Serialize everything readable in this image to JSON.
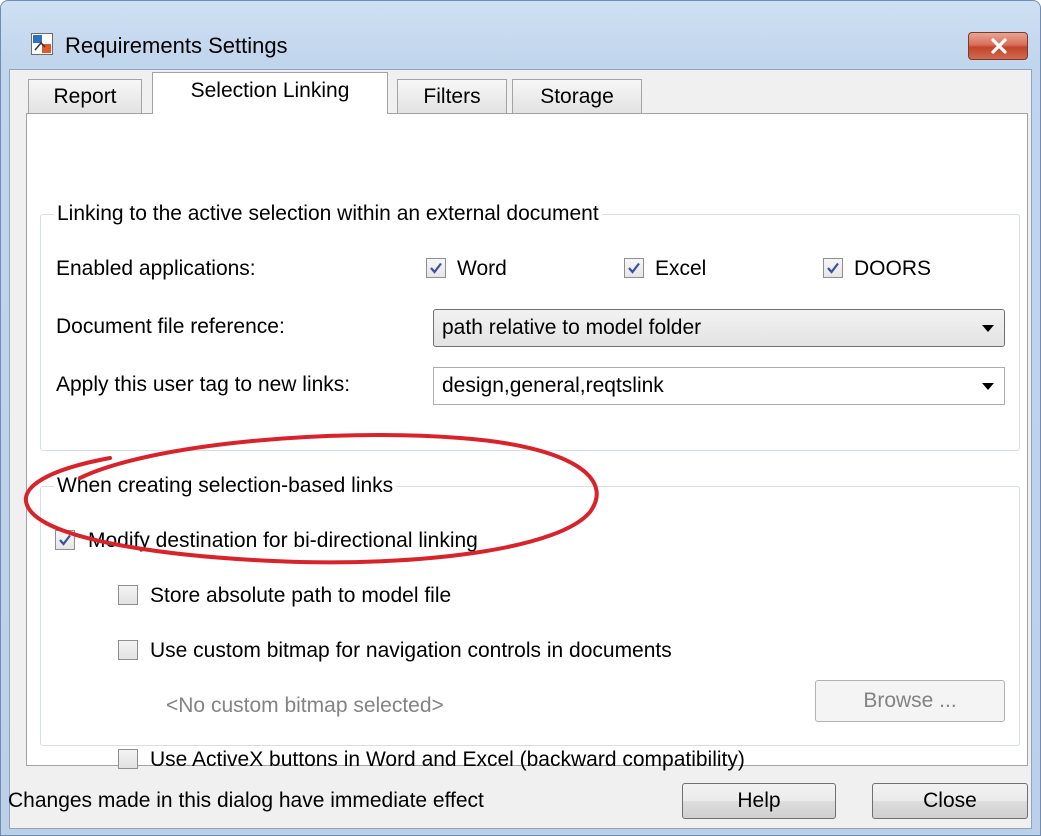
{
  "window": {
    "title": "Requirements Settings"
  },
  "tabs": [
    {
      "label": "Report"
    },
    {
      "label": "Selection Linking"
    },
    {
      "label": "Filters"
    },
    {
      "label": "Storage"
    }
  ],
  "external_group": {
    "legend": "Linking to the active selection within an external document",
    "enabled_label": "Enabled applications:",
    "apps": [
      {
        "label": "Word",
        "checked": true
      },
      {
        "label": "Excel",
        "checked": true
      },
      {
        "label": "DOORS",
        "checked": true
      }
    ],
    "doc_ref_label": "Document file reference:",
    "doc_ref_value": "path relative to model folder",
    "user_tag_label": "Apply this user tag to new links:",
    "user_tag_value": "design,general,reqtslink"
  },
  "creating_group": {
    "legend": "When creating selection-based links",
    "modify_dest": {
      "label": "Modify destination for bi-directional linking",
      "checked": true
    },
    "store_abs": {
      "label": "Store absolute path to model file",
      "checked": false
    },
    "custom_bitmap": {
      "label": "Use custom bitmap for navigation controls in documents",
      "checked": false
    },
    "no_bitmap": "<No custom bitmap selected>",
    "browse": "Browse ...",
    "activex": {
      "label": "Use ActiveX buttons in Word and Excel (backward compatibility)",
      "checked": false
    }
  },
  "footer": {
    "status": "Changes made in this dialog have immediate effect",
    "help": "Help",
    "close": "Close"
  },
  "colors": {
    "annotation": "#d8232a",
    "titlebar": "#c1d5ec",
    "close_button": "#c3442b"
  }
}
